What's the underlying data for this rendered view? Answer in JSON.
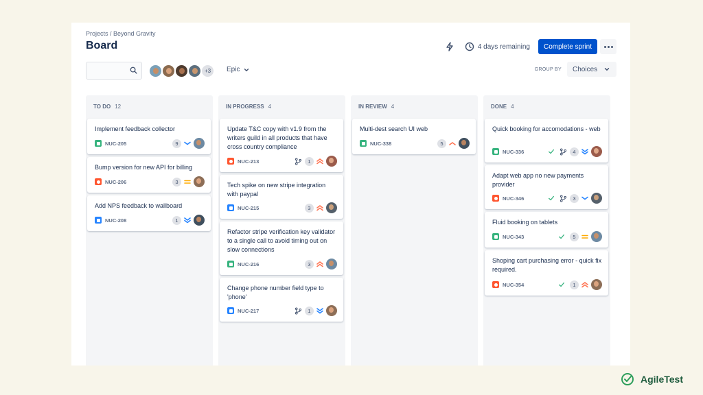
{
  "header": {
    "breadcrumb": "Projects / Beyond Gravity",
    "title": "Board",
    "remaining": "4 days remaining",
    "complete_label": "Complete sprint"
  },
  "toolbar": {
    "search_placeholder": "",
    "more_members": "+3",
    "epic_label": "Epic",
    "group_by_label": "GROUP BY",
    "choices_label": "Choices"
  },
  "colors": {
    "primary": "#0052cc",
    "story": "#36b37e",
    "bug": "#ff5630",
    "task": "#2684ff",
    "priority_high": "#ff7452",
    "priority_medium": "#ffab00",
    "priority_low": "#2684ff",
    "done_check": "#36b37e"
  },
  "columns": [
    {
      "name": "TO DO",
      "count": "12",
      "cards": [
        {
          "title": "Implement feedback collector",
          "key": "NUC-205",
          "type": "story",
          "estimate": "9",
          "priority": "low"
        },
        {
          "title": "Bump version for new API for billing",
          "key": "NUC-206",
          "type": "bug",
          "estimate": "3",
          "priority": "medium"
        },
        {
          "title": "Add NPS feedback to wallboard",
          "key": "NUC-208",
          "type": "task",
          "estimate": "1",
          "priority": "lowest"
        }
      ]
    },
    {
      "name": "IN PROGRESS",
      "count": "4",
      "cards": [
        {
          "title": "Update T&C copy with v1.9 from the writers guild in all products that have cross country compliance",
          "key": "NUC-213",
          "type": "bug",
          "estimate": "1",
          "priority": "highest",
          "branch": true
        },
        {
          "title": "Tech spike on new stripe integration with paypal",
          "key": "NUC-215",
          "type": "task",
          "estimate": "3",
          "priority": "highest"
        },
        {
          "title": "Refactor stripe verification key validator to a single call to avoid timing out on slow connections",
          "key": "NUC-216",
          "type": "story",
          "estimate": "3",
          "priority": "highest"
        },
        {
          "title": "Change phone number field type to 'phone'",
          "key": "NUC-217",
          "type": "task",
          "estimate": "1",
          "priority": "lowest",
          "branch": true
        }
      ]
    },
    {
      "name": "IN REVIEW",
      "count": "4",
      "cards": [
        {
          "title": "Multi-dest search UI web",
          "key": "NUC-338",
          "type": "story",
          "estimate": "5",
          "priority": "high"
        }
      ]
    },
    {
      "name": "DONE",
      "count": "4",
      "cards": [
        {
          "title": "Quick booking for accomodations - web",
          "key": "NUC-336",
          "type": "story",
          "estimate": "4",
          "priority": "lowest",
          "done": true,
          "branch": true
        },
        {
          "title": "Adapt web app no new payments provider",
          "key": "NUC-346",
          "type": "bug",
          "estimate": "3",
          "priority": "low",
          "done": true,
          "branch": true
        },
        {
          "title": "Fluid booking on tablets",
          "key": "NUC-343",
          "type": "story",
          "estimate": "5",
          "priority": "medium",
          "done": true
        },
        {
          "title": "Shoping cart purchasing error - quick fix required.",
          "key": "NUC-354",
          "type": "bug",
          "estimate": "1",
          "priority": "highest",
          "done": true
        }
      ]
    }
  ],
  "brand": {
    "name": "AgileTest"
  }
}
